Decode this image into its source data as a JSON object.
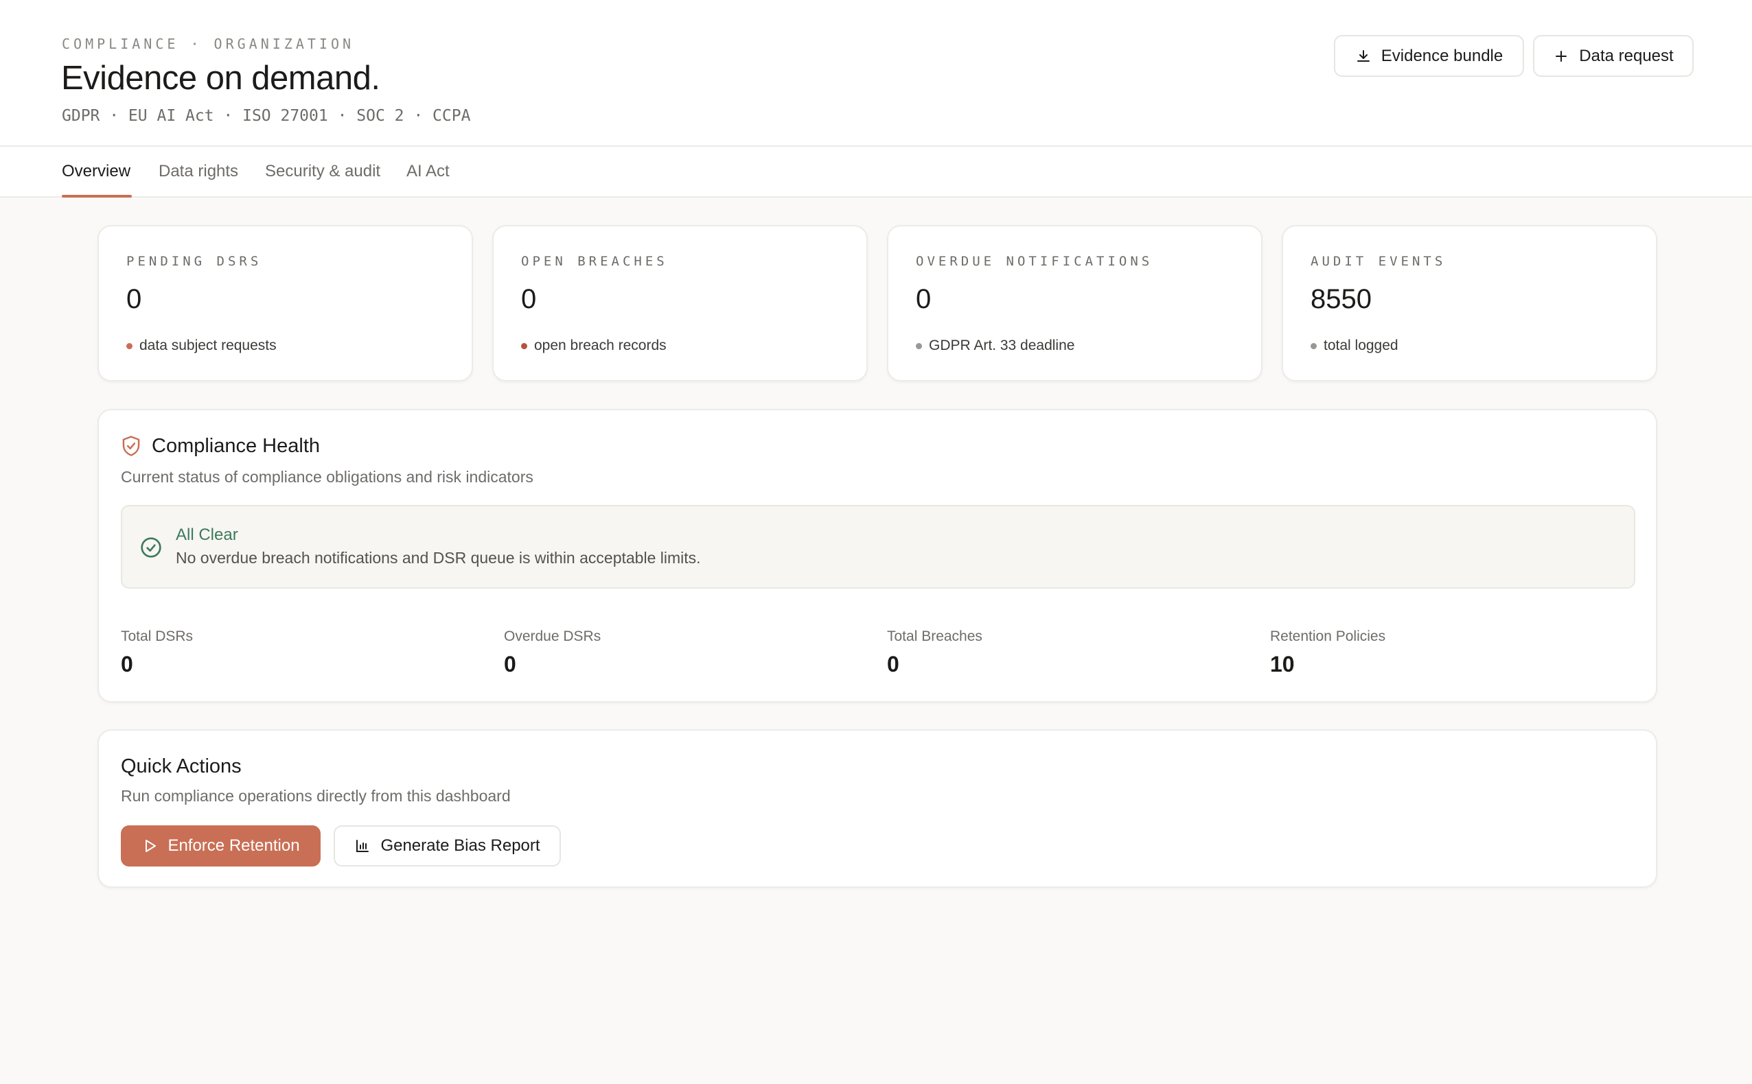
{
  "header": {
    "eyebrow": "COMPLIANCE · ORGANIZATION",
    "title": "Evidence on demand.",
    "frameworks": "GDPR · EU AI Act · ISO 27001 · SOC 2 · CCPA",
    "evidence_button": "Evidence bundle",
    "request_button": "Data request"
  },
  "tabs": [
    {
      "label": "Overview",
      "active": true
    },
    {
      "label": "Data rights",
      "active": false
    },
    {
      "label": "Security & audit",
      "active": false
    },
    {
      "label": "AI Act",
      "active": false
    }
  ],
  "stats": [
    {
      "label": "PENDING DSRS",
      "value": "0",
      "note": "data subject requests",
      "dot_color": "#c96f55"
    },
    {
      "label": "OPEN BREACHES",
      "value": "0",
      "note": "open breach records",
      "dot_color": "#b5533a"
    },
    {
      "label": "OVERDUE NOTIFICATIONS",
      "value": "0",
      "note": "GDPR Art. 33 deadline",
      "dot_color": "#9a9894"
    },
    {
      "label": "AUDIT EVENTS",
      "value": "8550",
      "note": "total logged",
      "dot_color": "#9a9894"
    }
  ],
  "health": {
    "title": "Compliance Health",
    "subtitle": "Current status of compliance obligations and risk indicators",
    "status_title": "All Clear",
    "status_desc": "No overdue breach notifications and DSR queue is within acceptable limits.",
    "metrics": [
      {
        "label": "Total DSRs",
        "value": "0"
      },
      {
        "label": "Overdue DSRs",
        "value": "0"
      },
      {
        "label": "Total Breaches",
        "value": "0"
      },
      {
        "label": "Retention Policies",
        "value": "10"
      }
    ]
  },
  "actions": {
    "title": "Quick Actions",
    "subtitle": "Run compliance operations directly from this dashboard",
    "enforce_label": "Enforce Retention",
    "bias_label": "Generate Bias Report"
  },
  "colors": {
    "accent": "#c96f55",
    "success": "#3d7a5a"
  }
}
